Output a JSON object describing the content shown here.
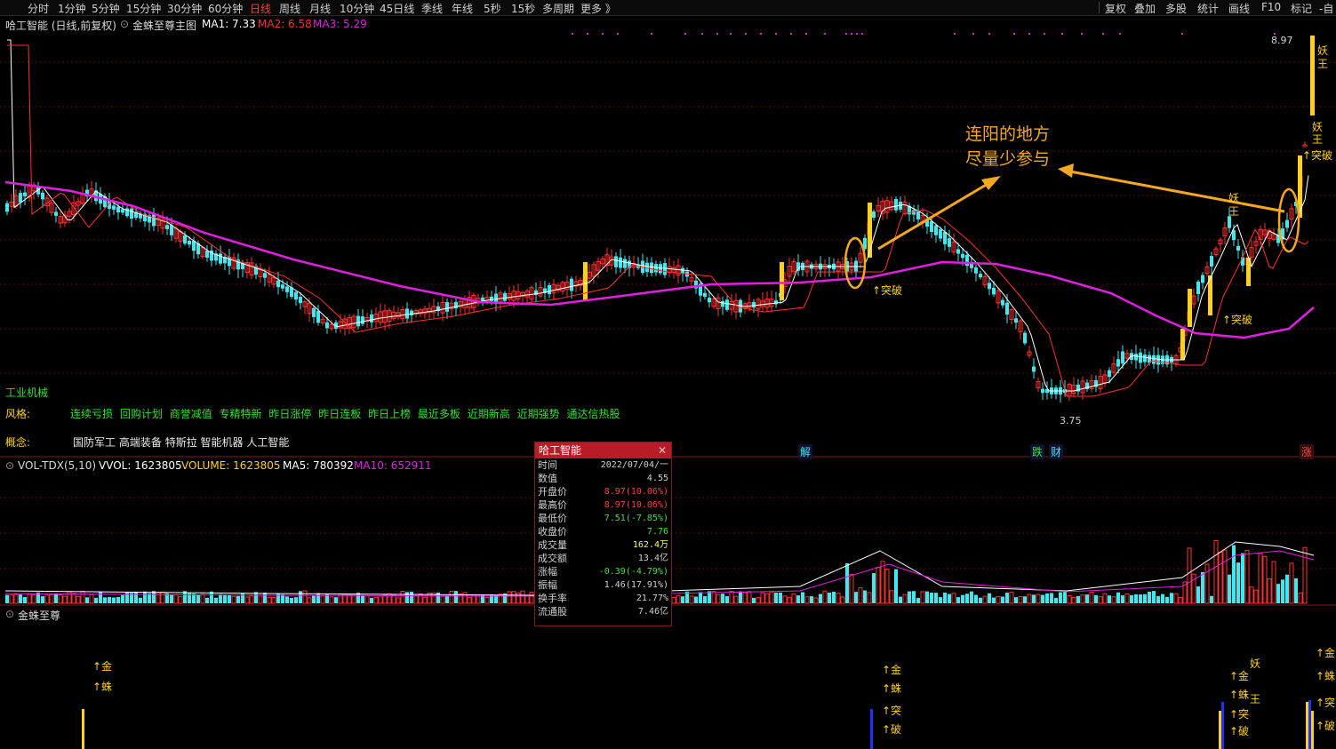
{
  "toolbar": {
    "periods": [
      "分时",
      "1分钟",
      "5分钟",
      "15分钟",
      "30分钟",
      "60分钟",
      "日线",
      "周线",
      "月线",
      "10分钟",
      "45日线",
      "季线",
      "年线",
      "5秒",
      "15秒",
      "多周期",
      "更多 》"
    ],
    "active_period": "日线",
    "right_tools": [
      "复权",
      "叠加",
      "多股",
      "统计",
      "画线",
      "F10",
      "标记",
      "-自"
    ]
  },
  "main_panel": {
    "stock_title": "哈工智能 (日线,前复权)",
    "indicator_name": "金蛛至尊主图",
    "ma1": "MA1: 7.33",
    "ma2": "MA2: 6.58",
    "ma3": "MA3: 5.29",
    "high_label": "8.97",
    "low_label": "3.75",
    "annotation_line1": "连阳的地方",
    "annotation_line2": "尽量少参与",
    "industry": "工业机械",
    "style_label": "风格:",
    "style_tags": [
      "连续亏损",
      "回购计划",
      "商誉减值",
      "专精特新",
      "昨日涨停",
      "昨日连板",
      "昨日上榜",
      "最近多板",
      "近期新高",
      "近期强势",
      "通达信热股"
    ],
    "concept_label": "概念:",
    "concept_tags": [
      "国防军工",
      "高端装备",
      "特斯拉",
      "智能机器",
      "人工智能"
    ],
    "signal_breakthrough": "↑突破",
    "yao": "妖",
    "wang": "王",
    "event_jie": "解",
    "event_die": "跌",
    "event_cai": "财",
    "event_zhang": "涨",
    "right_breakthrough": "↑突破"
  },
  "volume_panel": {
    "name": "VOL-TDX(5,10)",
    "vvol": "VVOL: 1623805",
    "volume": "VOLUME: 1623805",
    "ma5": "MA5: 780392",
    "ma10": "MA10: 652911"
  },
  "bottom_panel": {
    "name": "金蛛至尊",
    "sig_jin": "↑金",
    "sig_zhu": "↑蛛",
    "sig_tu": "↑突",
    "sig_po": "↑破"
  },
  "info_popup": {
    "title": "哈工智能",
    "close": "✕",
    "rows": [
      {
        "k": "时间",
        "v": "2022/07/04/一",
        "c": "#d0d0d0"
      },
      {
        "k": "数值",
        "v": "4.55",
        "c": "#d0d0d0"
      },
      {
        "k": "开盘价",
        "v": "8.97(10.06%)",
        "c": "#ff4040"
      },
      {
        "k": "最高价",
        "v": "8.97(10.06%)",
        "c": "#ff4040"
      },
      {
        "k": "最低价",
        "v": "7.51(-7.85%)",
        "c": "#40e040"
      },
      {
        "k": "收盘价",
        "v": "7.76",
        "c": "#40e040"
      },
      {
        "k": "成交量",
        "v": "162.4万",
        "c": "#ffff40"
      },
      {
        "k": "成交额",
        "v": "13.4亿",
        "c": "#d0d0d0"
      },
      {
        "k": "涨幅",
        "v": "-0.39(-4.79%)",
        "c": "#40e040"
      },
      {
        "k": "振幅",
        "v": "1.46(17.91%)",
        "c": "#d0d0d0"
      },
      {
        "k": "换手率",
        "v": "21.77%",
        "c": "#d0d0d0"
      },
      {
        "k": "流通股",
        "v": "7.46亿",
        "c": "#d0d0d0"
      }
    ]
  },
  "colors": {
    "ma1": "#ffffff",
    "ma2": "#ff3030",
    "ma3": "#e020e0",
    "up": "#ff3030",
    "down": "#40e8f0",
    "signal_yellow": "#ffd020",
    "annotation": "#f4a820",
    "tag_green": "#30e030"
  }
}
